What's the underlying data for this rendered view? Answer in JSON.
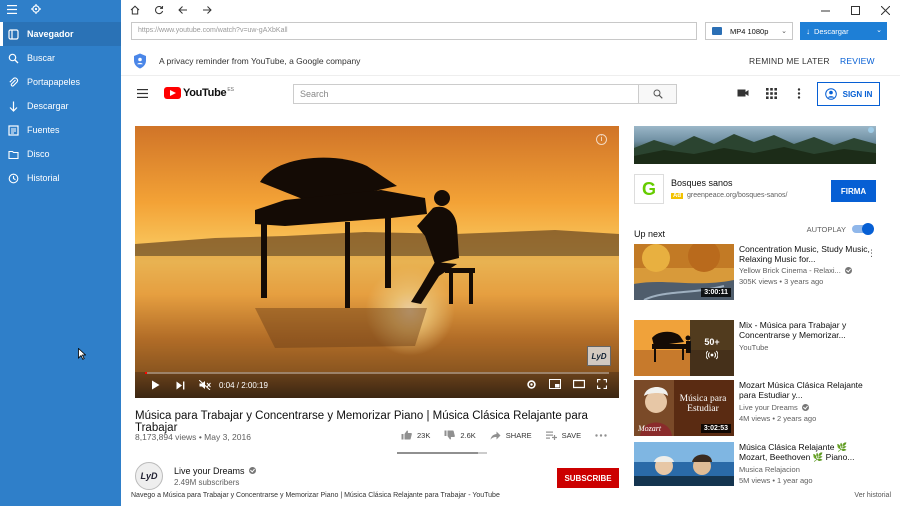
{
  "sidebar": {
    "items": [
      {
        "label": "Navegador",
        "icon": "browser-icon",
        "active": true
      },
      {
        "label": "Buscar",
        "icon": "search-icon"
      },
      {
        "label": "Portapapeles",
        "icon": "paperclip-icon"
      },
      {
        "label": "Descargar",
        "icon": "download-arrow-icon"
      },
      {
        "label": "Fuentes",
        "icon": "sources-icon"
      },
      {
        "label": "Disco",
        "icon": "folder-icon"
      },
      {
        "label": "Historial",
        "icon": "history-icon"
      }
    ]
  },
  "browser": {
    "url": "https://www.youtube.com/watch?v=uw-gAXbKall",
    "format": "MP4 1080p",
    "download_label": "Descargar"
  },
  "privacy": {
    "message": "A privacy reminder from YouTube, a Google company",
    "remind_label": "REMIND ME LATER",
    "review_label": "REVIEW"
  },
  "youtube": {
    "logo_text": "YouTube",
    "country": "ES",
    "search_placeholder": "Search",
    "signin_label": "SIGN IN"
  },
  "player": {
    "time": "0:04 / 2:00:19",
    "progress": 0.0006,
    "watermark": "LyD",
    "info": "i"
  },
  "video": {
    "title": "Música para Trabajar y Concentrarse y Memorizar Piano | Música Clásica Relajante para Trabajar",
    "views": "8,173,894 views",
    "date": "May 3, 2016",
    "likes": "23K",
    "dislikes": "2.6K",
    "share_label": "SHARE",
    "save_label": "SAVE",
    "like_ratio": 0.9
  },
  "channel": {
    "avatar_text": "LyD",
    "name": "Live your Dreams",
    "subscribers": "2.49M subscribers",
    "subscribe_label": "SUBSCRIBE"
  },
  "status": {
    "text": "Navego a Música para Trabajar y Concentrarse y Memorizar Piano | Música Clásica Relajante para Trabajar - YouTube",
    "history_link": "Ver historial"
  },
  "ad": {
    "logo_letter": "G",
    "title": "Bosques sanos",
    "badge": "Ad",
    "url": "greenpeace.org/bosques-sanos/",
    "cta": "FIRMA"
  },
  "upnext": {
    "label": "Up next",
    "autoplay_label": "AUTOPLAY",
    "autoplay_on": true,
    "items": [
      {
        "title": "Concentration Music, Study Music, Relaxing Music for...",
        "channel": "Yellow Brick Cinema - Relaxi...",
        "verified": true,
        "meta": "305K views • 3 years ago",
        "duration": "3:00:11"
      },
      {
        "title": "Mix - Música para Trabajar y Concentrarse y Memorizar...",
        "channel": "YouTube",
        "verified": false,
        "meta": "",
        "duration": "",
        "mix_count": "50+"
      },
      {
        "title": "Mozart Música Clásica Relajante para Estudiar y...",
        "channel": "Live your Dreams",
        "verified": true,
        "meta": "4M views • 2 years ago",
        "duration": "3:02:53",
        "thumb_text": "Música para Estudiar",
        "thumb_sign": "Mozart"
      },
      {
        "title": "Música Clásica Relajante 🌿 Mozart, Beethoven 🌿 Piano...",
        "channel": "Musica Relajacion",
        "verified": false,
        "meta": "5M views • 1 year ago",
        "duration": ""
      }
    ]
  }
}
